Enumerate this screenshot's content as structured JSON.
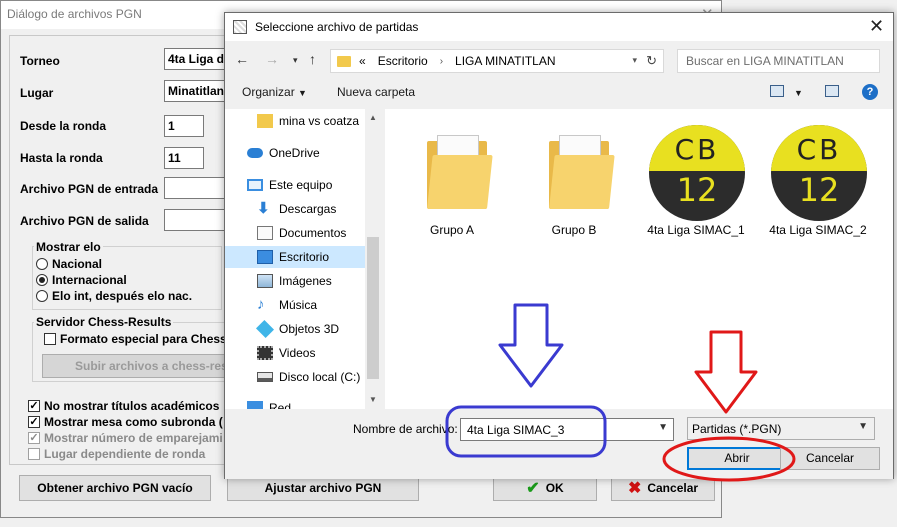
{
  "pgn_dialog": {
    "title": "Diálogo de archivos PGN",
    "fields": [
      {
        "label": "Torneo",
        "value": "4ta Liga de"
      },
      {
        "label": "Lugar",
        "value": "Minatitlan,"
      },
      {
        "label": "Desde la ronda",
        "value": "1"
      },
      {
        "label": "Hasta la ronda",
        "value": "11"
      },
      {
        "label": "Archivo PGN de entrada",
        "value": ""
      },
      {
        "label": "Archivo PGN de salida",
        "value": ""
      }
    ],
    "elo_group": {
      "title": "Mostrar elo",
      "options": [
        "Nacional",
        "Internacional",
        "Elo int, después elo nac."
      ],
      "selected": "Internacional"
    },
    "server_group": {
      "title": "Servidor Chess-Results",
      "checkbox": "Formato especial para Chess",
      "button": "Subir archivos a chess-res"
    },
    "checks": [
      {
        "label": "No mostrar títulos académicos",
        "checked": true,
        "enabled": true
      },
      {
        "label": "Mostrar mesa como subronda (",
        "checked": true,
        "enabled": true
      },
      {
        "label": "Mostrar número de emparejami",
        "checked": true,
        "enabled": false
      },
      {
        "label": "Lugar dependiente de ronda",
        "checked": false,
        "enabled": false
      }
    ],
    "buttons": {
      "empty": "Obtener archivo PGN vacío",
      "adjust": "Ajustar archivo PGN",
      "ok": "OK",
      "cancel": "Cancelar"
    }
  },
  "file_dialog": {
    "title": "Seleccione archivo de partidas",
    "address": {
      "overflow": "«",
      "segments": [
        "Escritorio",
        "LIGA MINATITLAN"
      ]
    },
    "search_placeholder": "Buscar en LIGA MINATITLAN",
    "toolbar": {
      "organize": "Organizar",
      "new_folder": "Nueva carpeta",
      "help": "?"
    },
    "nav_items": [
      {
        "label": "mina vs coatza",
        "icon": "folder-icon"
      },
      {
        "label": "OneDrive",
        "icon": "cloud-icon"
      },
      {
        "label": "Este equipo",
        "icon": "computer-icon"
      },
      {
        "label": "Descargas",
        "icon": "download-icon"
      },
      {
        "label": "Documentos",
        "icon": "document-icon"
      },
      {
        "label": "Escritorio",
        "icon": "desktop-icon",
        "selected": true
      },
      {
        "label": "Imágenes",
        "icon": "image-icon"
      },
      {
        "label": "Música",
        "icon": "music-icon"
      },
      {
        "label": "Objetos 3D",
        "icon": "cube-icon"
      },
      {
        "label": "Videos",
        "icon": "video-icon"
      },
      {
        "label": "Disco local (C:)",
        "icon": "drive-icon"
      },
      {
        "label": "Red",
        "icon": "network-icon"
      }
    ],
    "files": [
      {
        "name": "Grupo A",
        "type": "folder"
      },
      {
        "name": "Grupo B",
        "type": "folder"
      },
      {
        "name": "4ta Liga SIMAC_1",
        "type": "cb12"
      },
      {
        "name": "4ta Liga SIMAC_2",
        "type": "cb12"
      }
    ],
    "cb_icon": {
      "line1": "CB",
      "line2": "12"
    },
    "filename_label": "Nombre de archivo:",
    "filename_value": "4ta Liga SIMAC_3",
    "filter_value": "Partidas (*.PGN)",
    "open_button": "Abrir",
    "cancel_button": "Cancelar"
  },
  "colors": {
    "annotation_blue": "#3a3ad0",
    "annotation_red": "#e01818",
    "selection": "#cce8ff",
    "accent": "#0078d7"
  }
}
